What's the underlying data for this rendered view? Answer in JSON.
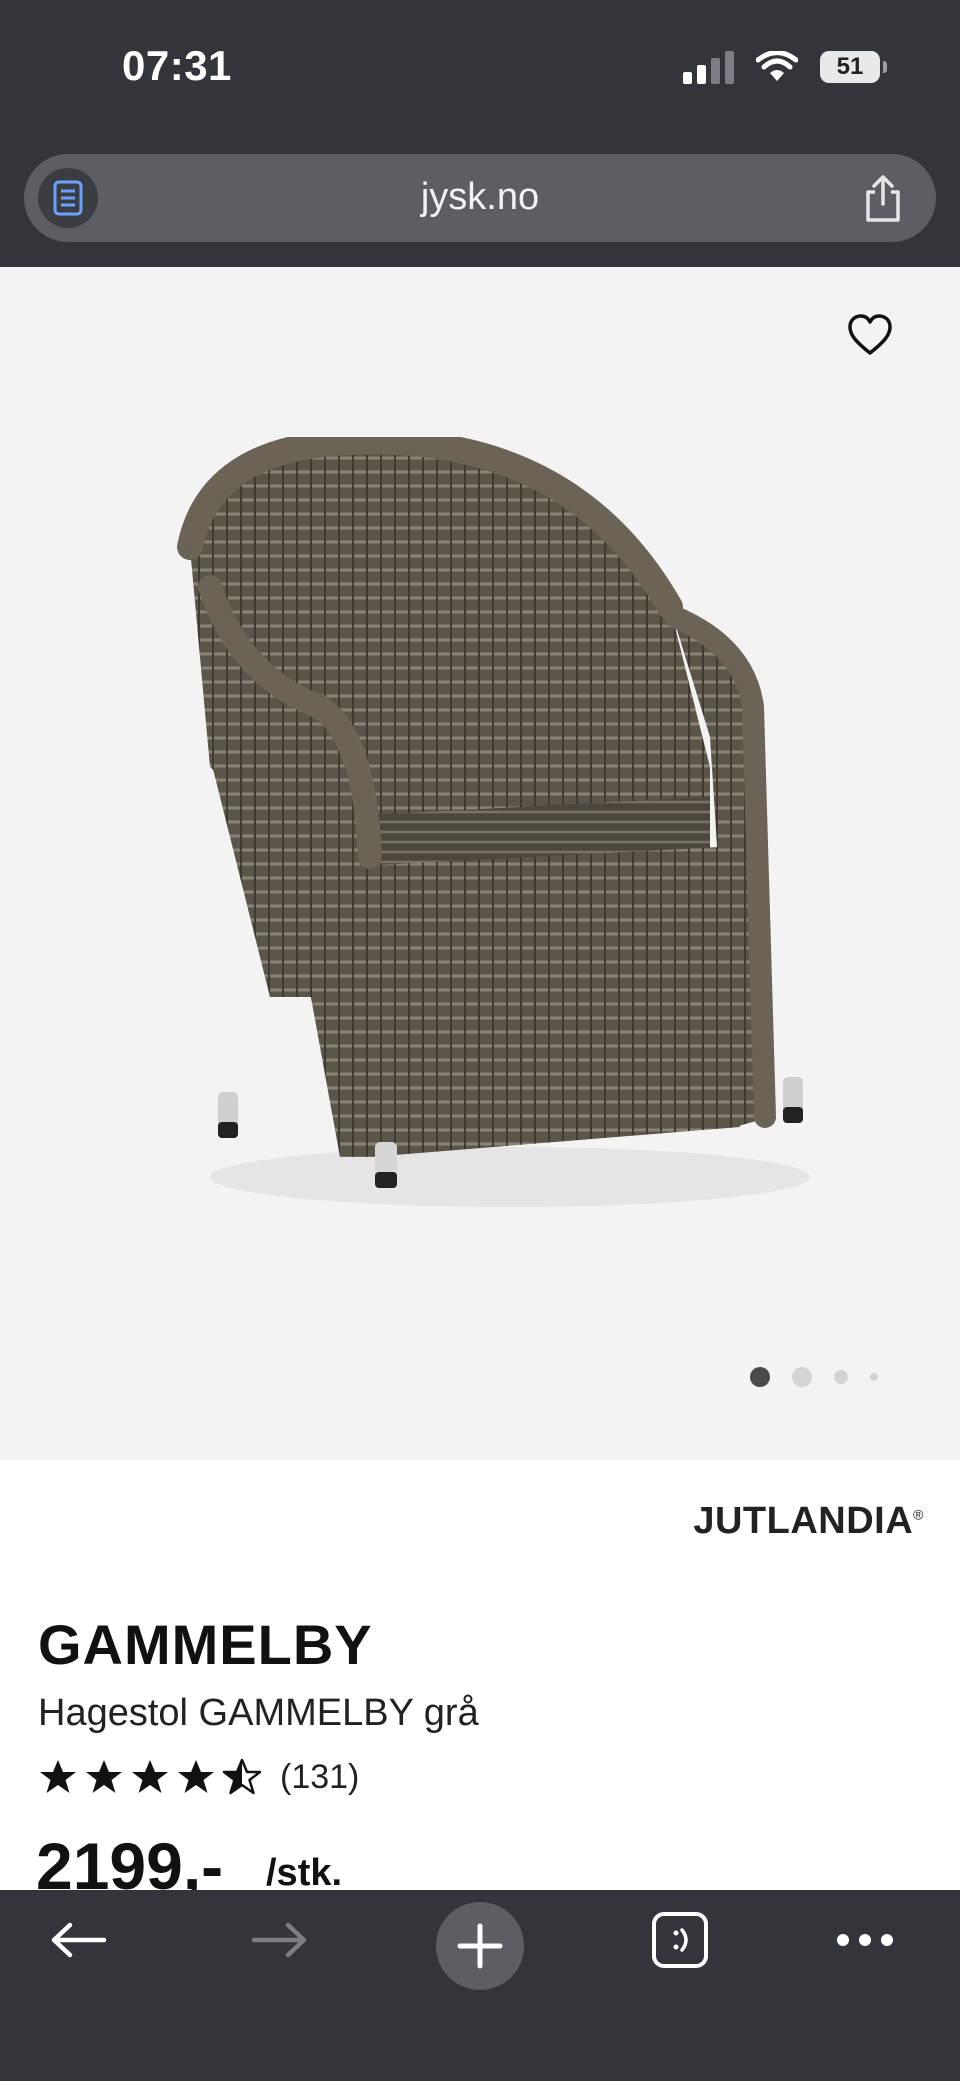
{
  "status_bar": {
    "time": "07:31",
    "battery": "51"
  },
  "browser": {
    "url": "jysk.no"
  },
  "product": {
    "brand": "JUTLANDIA",
    "brand_mark": "®",
    "name": "GAMMELBY",
    "description": "Hagestol GAMMELBY grå",
    "rating": 4.5,
    "rating_count": "(131)",
    "price": "2199,-",
    "unit": "/stk.",
    "images_total": 4,
    "image_active": 1,
    "colors": {
      "accent": "#111111",
      "chair": "#5a5449"
    }
  },
  "toolbar": {
    "icons": [
      "back-arrow-icon",
      "forward-arrow-icon",
      "plus-icon",
      "tabs-icon",
      "more-icon"
    ]
  }
}
